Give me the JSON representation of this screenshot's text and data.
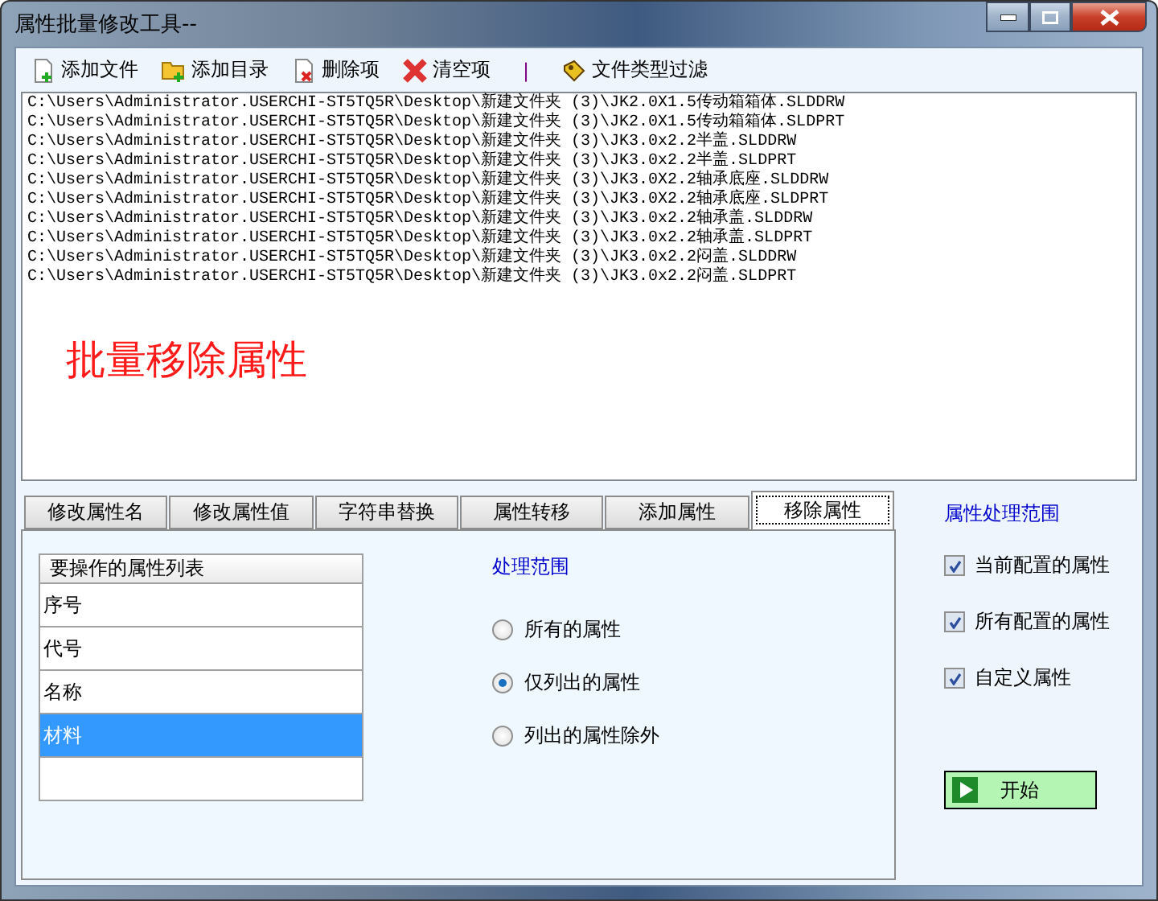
{
  "window": {
    "title": "属性批量修改工具--"
  },
  "toolbar": [
    {
      "kind": "add-file",
      "label": "添加文件"
    },
    {
      "kind": "add-folder",
      "label": "添加目录"
    },
    {
      "kind": "delete",
      "label": "删除项"
    },
    {
      "kind": "clear",
      "label": "清空项"
    },
    {
      "kind": "separator",
      "label": "|"
    },
    {
      "kind": "filter",
      "label": "文件类型过滤"
    }
  ],
  "files": [
    "C:\\Users\\Administrator.USERCHI-ST5TQ5R\\Desktop\\新建文件夹 (3)\\JK2.0X1.5传动箱箱体.SLDDRW",
    "C:\\Users\\Administrator.USERCHI-ST5TQ5R\\Desktop\\新建文件夹 (3)\\JK2.0X1.5传动箱箱体.SLDPRT",
    "C:\\Users\\Administrator.USERCHI-ST5TQ5R\\Desktop\\新建文件夹 (3)\\JK3.0x2.2半盖.SLDDRW",
    "C:\\Users\\Administrator.USERCHI-ST5TQ5R\\Desktop\\新建文件夹 (3)\\JK3.0x2.2半盖.SLDPRT",
    "C:\\Users\\Administrator.USERCHI-ST5TQ5R\\Desktop\\新建文件夹 (3)\\JK3.0X2.2轴承底座.SLDDRW",
    "C:\\Users\\Administrator.USERCHI-ST5TQ5R\\Desktop\\新建文件夹 (3)\\JK3.0X2.2轴承底座.SLDPRT",
    "C:\\Users\\Administrator.USERCHI-ST5TQ5R\\Desktop\\新建文件夹 (3)\\JK3.0x2.2轴承盖.SLDDRW",
    "C:\\Users\\Administrator.USERCHI-ST5TQ5R\\Desktop\\新建文件夹 (3)\\JK3.0x2.2轴承盖.SLDPRT",
    "C:\\Users\\Administrator.USERCHI-ST5TQ5R\\Desktop\\新建文件夹 (3)\\JK3.0x2.2闷盖.SLDDRW",
    "C:\\Users\\Administrator.USERCHI-ST5TQ5R\\Desktop\\新建文件夹 (3)\\JK3.0x2.2闷盖.SLDPRT"
  ],
  "mode_banner": "批量移除属性",
  "tabs": [
    {
      "label": "修改属性名",
      "selected": false
    },
    {
      "label": "修改属性值",
      "selected": false
    },
    {
      "label": "字符串替换",
      "selected": false
    },
    {
      "label": "属性转移",
      "selected": false
    },
    {
      "label": "添加属性",
      "selected": false
    },
    {
      "label": "移除属性",
      "selected": true
    }
  ],
  "property_list": {
    "header": "要操作的属性列表",
    "rows": [
      {
        "text": "序号",
        "selected": false
      },
      {
        "text": "代号",
        "selected": false
      },
      {
        "text": "名称",
        "selected": false
      },
      {
        "text": "材料",
        "selected": true
      }
    ]
  },
  "scope": {
    "title": "处理范围",
    "options": [
      {
        "label": "所有的属性",
        "selected": false
      },
      {
        "label": "仅列出的属性",
        "selected": true
      },
      {
        "label": "列出的属性除外",
        "selected": false
      }
    ]
  },
  "attribute_scope": {
    "title": "属性处理范围",
    "options": [
      {
        "label": "当前配置的属性",
        "checked": true
      },
      {
        "label": "所有配置的属性",
        "checked": true
      },
      {
        "label": "自定义属性",
        "checked": true
      }
    ]
  },
  "start_button": {
    "label": "开始"
  }
}
